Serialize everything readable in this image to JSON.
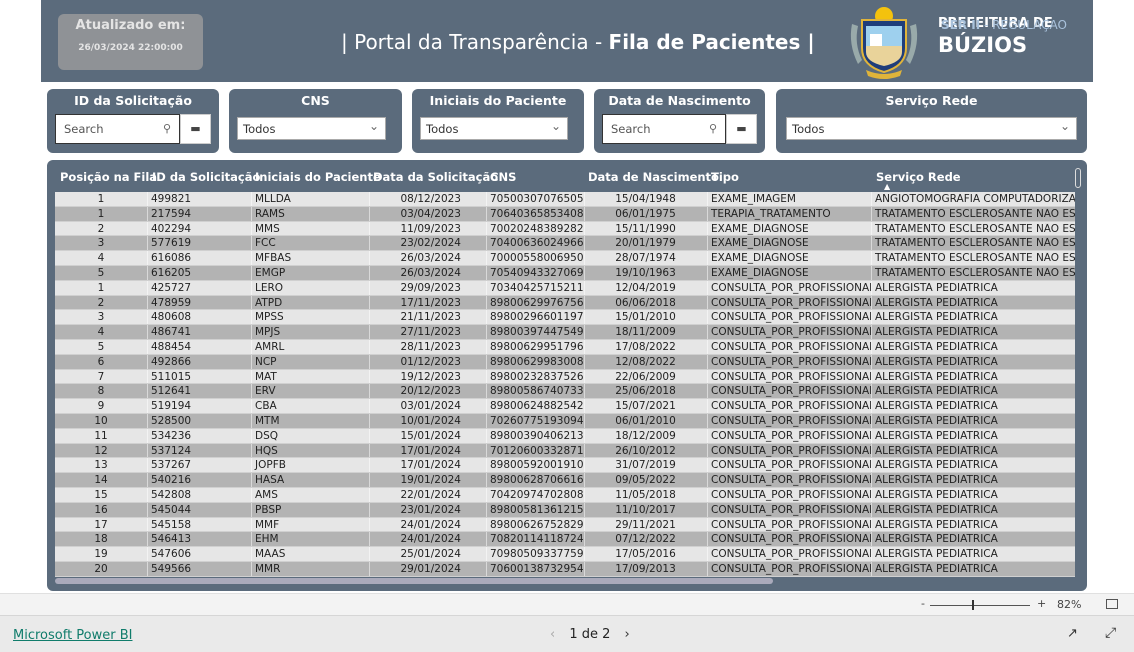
{
  "header": {
    "updated_label": "Atualizado em:",
    "updated_value": "26/03/2024 22:00:00",
    "title_prefix": "| Portal da Transparência - ",
    "title_bold": "Fila de Pacientes |",
    "pref_line1": "PREFEITURA DE",
    "pref_line2": "BÚZIOS",
    "pref_sub_a": "SER II",
    "pref_sub_b": " - REGULAÇÃO",
    "logo_text": "ARMAÇÃO DOS BÚZIOS"
  },
  "filters": [
    {
      "label": "ID da Solicitação",
      "type": "search",
      "placeholder": "Search"
    },
    {
      "label": "CNS",
      "type": "dropdown",
      "value": "Todos"
    },
    {
      "label": "Iniciais do Paciente",
      "type": "dropdown",
      "value": "Todos"
    },
    {
      "label": "Data de Nascimento",
      "type": "search",
      "placeholder": "Search"
    },
    {
      "label": "Serviço Rede",
      "type": "dropdown",
      "value": "Todos"
    }
  ],
  "table": {
    "columns": [
      "Posição na Fila",
      "ID da Solicitação",
      "Iniciais do Paciente",
      "Data da Solicitação",
      "CNS",
      "Data de Nascimento",
      "Tipo",
      "Serviço Rede"
    ],
    "sorted_column": "Serviço Rede",
    "rows": [
      [
        "1",
        "499821",
        "MLLDA",
        "08/12/2023",
        "705003070765055",
        "15/04/1948",
        "EXAME_IMAGEM",
        "ANGIOTOMOGRAFIA COMPUTADORIZAD"
      ],
      [
        "1",
        "217594",
        "RAMS",
        "03/04/2023",
        "706403658534087",
        "06/01/1975",
        "TERAPIA_TRATAMENTO",
        "TRATAMENTO ESCLEROSANTE NÃO ESTÉ"
      ],
      [
        "2",
        "402294",
        "MMS",
        "11/09/2023",
        "700202483892828",
        "15/11/1990",
        "EXAME_DIAGNOSE",
        "TRATAMENTO ESCLEROSANTE NÃO ESTÉ"
      ],
      [
        "3",
        "577619",
        "FCC",
        "23/02/2024",
        "704006360249666",
        "20/01/1979",
        "EXAME_DIAGNOSE",
        "TRATAMENTO ESCLEROSANTE NÃO ESTÉ"
      ],
      [
        "4",
        "616086",
        "MFBAS",
        "26/03/2024",
        "700005580069507",
        "28/07/1974",
        "EXAME_DIAGNOSE",
        "TRATAMENTO ESCLEROSANTE NÃO ESTÉ"
      ],
      [
        "5",
        "616205",
        "EMGP",
        "26/03/2024",
        "705409433270691",
        "19/10/1963",
        "EXAME_DIAGNOSE",
        "TRATAMENTO ESCLEROSANTE NÃO ESTÉ"
      ],
      [
        "1",
        "425727",
        "LERO",
        "29/09/2023",
        "703404257152112",
        "12/04/2019",
        "CONSULTA_POR_PROFISSIONAL",
        "ALERGISTA PEDIATRICA"
      ],
      [
        "2",
        "478959",
        "ATPD",
        "17/11/2023",
        "898006299767563",
        "06/06/2018",
        "CONSULTA_POR_PROFISSIONAL",
        "ALERGISTA PEDIATRICA"
      ],
      [
        "3",
        "480608",
        "MPSS",
        "21/11/2023",
        "898002966011973",
        "15/01/2010",
        "CONSULTA_POR_PROFISSIONAL",
        "ALERGISTA PEDIATRICA"
      ],
      [
        "4",
        "486741",
        "MPJS",
        "27/11/2023",
        "898003974475496",
        "18/11/2009",
        "CONSULTA_POR_PROFISSIONAL",
        "ALERGISTA PEDIATRICA"
      ],
      [
        "5",
        "488454",
        "AMRL",
        "28/11/2023",
        "898006299517966",
        "17/08/2022",
        "CONSULTA_POR_PROFISSIONAL",
        "ALERGISTA PEDIATRICA"
      ],
      [
        "6",
        "492866",
        "NCP",
        "01/12/2023",
        "898006299830087",
        "12/08/2022",
        "CONSULTA_POR_PROFISSIONAL",
        "ALERGISTA PEDIATRICA"
      ],
      [
        "7",
        "511015",
        "MAT",
        "19/12/2023",
        "898002328375261",
        "22/06/2009",
        "CONSULTA_POR_PROFISSIONAL",
        "ALERGISTA PEDIATRICA"
      ],
      [
        "8",
        "512641",
        "ERV",
        "20/12/2023",
        "898005867407332",
        "25/06/2018",
        "CONSULTA_POR_PROFISSIONAL",
        "ALERGISTA PEDIATRICA"
      ],
      [
        "9",
        "519194",
        "CBA",
        "03/01/2024",
        "898006248825426",
        "15/07/2021",
        "CONSULTA_POR_PROFISSIONAL",
        "ALERGISTA PEDIATRICA"
      ],
      [
        "10",
        "528500",
        "MTM",
        "10/01/2024",
        "702607751930948",
        "06/01/2010",
        "CONSULTA_POR_PROFISSIONAL",
        "ALERGISTA PEDIATRICA"
      ],
      [
        "11",
        "534236",
        "DSQ",
        "15/01/2024",
        "898003904062133",
        "18/12/2009",
        "CONSULTA_POR_PROFISSIONAL",
        "ALERGISTA PEDIATRICA"
      ],
      [
        "12",
        "537124",
        "HQS",
        "17/01/2024",
        "701206003328712",
        "26/10/2012",
        "CONSULTA_POR_PROFISSIONAL",
        "ALERGISTA PEDIATRICA"
      ],
      [
        "13",
        "537267",
        "JOPFB",
        "17/01/2024",
        "898005920019109",
        "31/07/2019",
        "CONSULTA_POR_PROFISSIONAL",
        "ALERGISTA PEDIATRICA"
      ],
      [
        "14",
        "540216",
        "HASA",
        "19/01/2024",
        "898006287066166",
        "09/05/2022",
        "CONSULTA_POR_PROFISSIONAL",
        "ALERGISTA PEDIATRICA"
      ],
      [
        "15",
        "542808",
        "AMS",
        "22/01/2024",
        "704209747028080",
        "11/05/2018",
        "CONSULTA_POR_PROFISSIONAL",
        "ALERGISTA PEDIATRICA"
      ],
      [
        "16",
        "545044",
        "PBSP",
        "23/01/2024",
        "898005813612159",
        "11/10/2017",
        "CONSULTA_POR_PROFISSIONAL",
        "ALERGISTA PEDIATRICA"
      ],
      [
        "17",
        "545158",
        "MMF",
        "24/01/2024",
        "898006267528296",
        "29/11/2021",
        "CONSULTA_POR_PROFISSIONAL",
        "ALERGISTA PEDIATRICA"
      ],
      [
        "18",
        "546413",
        "EHM",
        "24/01/2024",
        "708201141187246",
        "07/12/2022",
        "CONSULTA_POR_PROFISSIONAL",
        "ALERGISTA PEDIATRICA"
      ],
      [
        "19",
        "547606",
        "MAAS",
        "25/01/2024",
        "709805093377598",
        "17/05/2016",
        "CONSULTA_POR_PROFISSIONAL",
        "ALERGISTA PEDIATRICA"
      ],
      [
        "20",
        "549566",
        "MMR",
        "29/01/2024",
        "706001387329549",
        "17/09/2013",
        "CONSULTA_POR_PROFISSIONAL",
        "ALERGISTA PEDIATRICA"
      ]
    ]
  },
  "zoom": {
    "minus": "-",
    "plus": "+",
    "value": "82%",
    "level_percent": 82
  },
  "footer": {
    "link": "Microsoft Power BI",
    "page": "1 de 2",
    "prev": "‹",
    "next": "›"
  },
  "colors": {
    "header_bg": "#5b6b7c",
    "row_light": "#e6e6e6",
    "row_dark": "#b3b3b3",
    "link": "#107c6b"
  }
}
